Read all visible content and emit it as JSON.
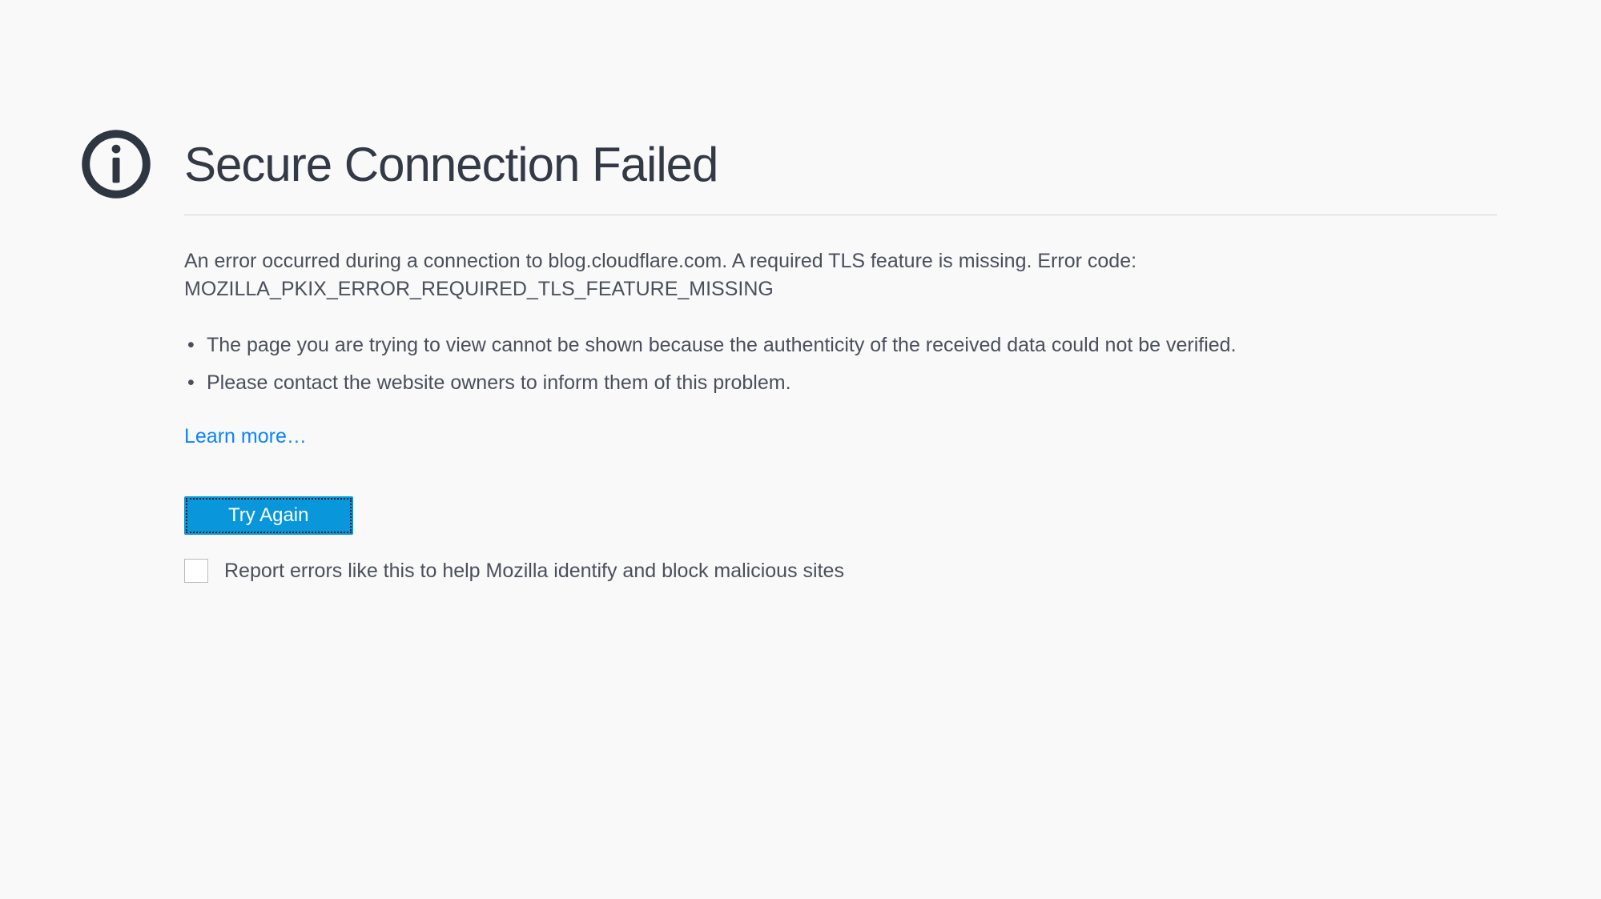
{
  "title": "Secure Connection Failed",
  "error_message": "An error occurred during a connection to blog.cloudflare.com. A required TLS feature is missing. Error code: MOZILLA_PKIX_ERROR_REQUIRED_TLS_FEATURE_MISSING",
  "bullets": [
    "The page you are trying to view cannot be shown because the authenticity of the received data could not be verified.",
    "Please contact the website owners to inform them of this problem."
  ],
  "learn_more_label": "Learn more…",
  "try_again_label": "Try Again",
  "report_checkbox_label": "Report errors like this to help Mozilla identify and block malicious sites"
}
